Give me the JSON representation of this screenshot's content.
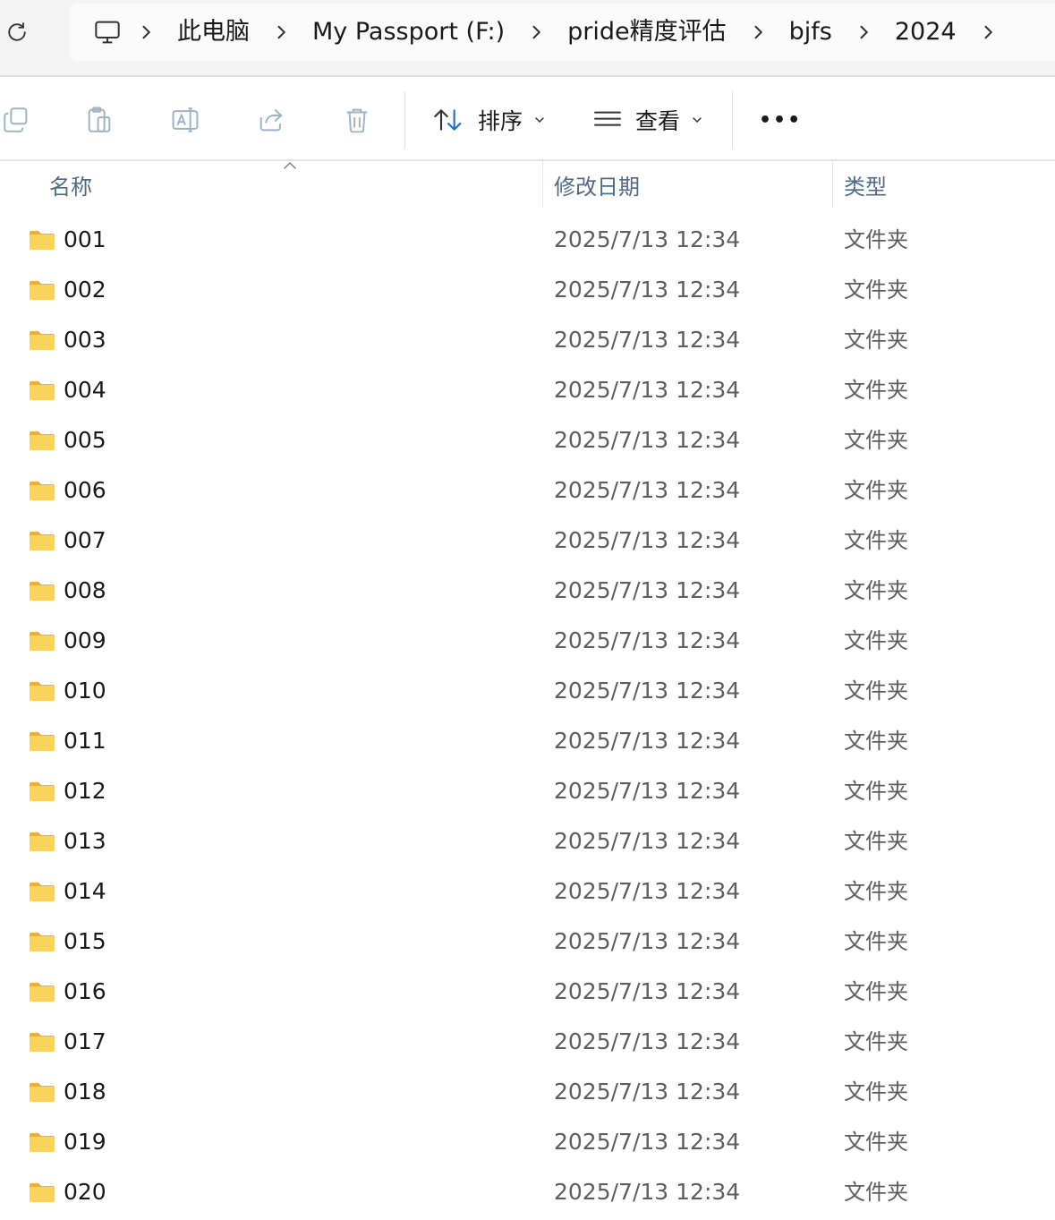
{
  "address_bar": {
    "refresh_icon": "refresh-icon",
    "pc_icon": "monitor-icon",
    "breadcrumbs": [
      "此电脑",
      "My Passport (F:)",
      "pride精度评估",
      "bjfs",
      "2024"
    ],
    "separator_icon": "chevron-right-icon"
  },
  "toolbar": {
    "icons": [
      "copy-icon",
      "paste-icon",
      "rename-icon",
      "share-icon",
      "delete-icon"
    ],
    "sort_label": "排序",
    "view_label": "查看",
    "more_label": "•••"
  },
  "columns": {
    "name": "名称",
    "date": "修改日期",
    "type": "类型",
    "sorted_by": "name"
  },
  "rows": [
    {
      "name": "001",
      "date": "2025/7/13 12:34",
      "type": "文件夹"
    },
    {
      "name": "002",
      "date": "2025/7/13 12:34",
      "type": "文件夹"
    },
    {
      "name": "003",
      "date": "2025/7/13 12:34",
      "type": "文件夹"
    },
    {
      "name": "004",
      "date": "2025/7/13 12:34",
      "type": "文件夹"
    },
    {
      "name": "005",
      "date": "2025/7/13 12:34",
      "type": "文件夹"
    },
    {
      "name": "006",
      "date": "2025/7/13 12:34",
      "type": "文件夹"
    },
    {
      "name": "007",
      "date": "2025/7/13 12:34",
      "type": "文件夹"
    },
    {
      "name": "008",
      "date": "2025/7/13 12:34",
      "type": "文件夹"
    },
    {
      "name": "009",
      "date": "2025/7/13 12:34",
      "type": "文件夹"
    },
    {
      "name": "010",
      "date": "2025/7/13 12:34",
      "type": "文件夹"
    },
    {
      "name": "011",
      "date": "2025/7/13 12:34",
      "type": "文件夹"
    },
    {
      "name": "012",
      "date": "2025/7/13 12:34",
      "type": "文件夹"
    },
    {
      "name": "013",
      "date": "2025/7/13 12:34",
      "type": "文件夹"
    },
    {
      "name": "014",
      "date": "2025/7/13 12:34",
      "type": "文件夹"
    },
    {
      "name": "015",
      "date": "2025/7/13 12:34",
      "type": "文件夹"
    },
    {
      "name": "016",
      "date": "2025/7/13 12:34",
      "type": "文件夹"
    },
    {
      "name": "017",
      "date": "2025/7/13 12:34",
      "type": "文件夹"
    },
    {
      "name": "018",
      "date": "2025/7/13 12:34",
      "type": "文件夹"
    },
    {
      "name": "019",
      "date": "2025/7/13 12:34",
      "type": "文件夹"
    },
    {
      "name": "020",
      "date": "2025/7/13 12:34",
      "type": "文件夹"
    }
  ],
  "colors": {
    "folder": "#f7c846",
    "header_text": "#4f6a88",
    "sort_accent": "#1f6fc0"
  }
}
